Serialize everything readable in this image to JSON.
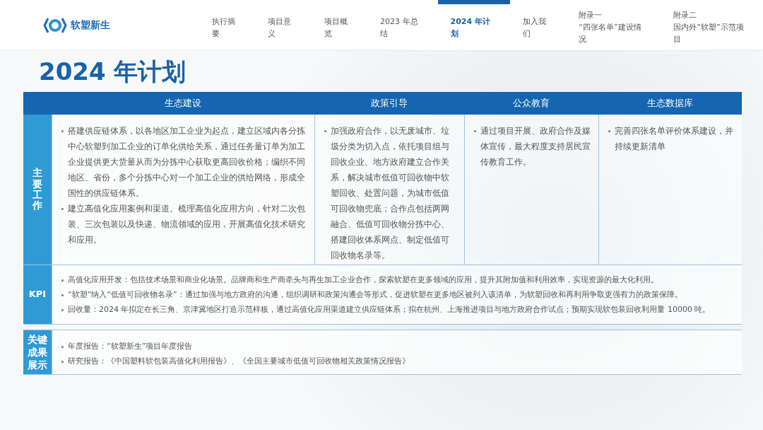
{
  "logo": {
    "name": "软塑新生"
  },
  "nav": [
    {
      "lines": [
        "执行摘要"
      ],
      "selected": false
    },
    {
      "lines": [
        "项目意义"
      ],
      "selected": false
    },
    {
      "lines": [
        "项目概览"
      ],
      "selected": false
    },
    {
      "lines": [
        "2023 年总结"
      ],
      "selected": false
    },
    {
      "lines": [
        "2024 年计划"
      ],
      "selected": true
    },
    {
      "lines": [
        "加入我们"
      ],
      "selected": false
    },
    {
      "lines": [
        "附录一",
        "“四张名单”建设情况"
      ],
      "selected": false
    },
    {
      "lines": [
        "附录二",
        "国内外“软塑”示范项目"
      ],
      "selected": false
    }
  ],
  "title": "2024 年计划",
  "table": {
    "columns": [
      "生态建设",
      "政策引导",
      "公众教育",
      "生态数据库"
    ],
    "rows": [
      {
        "label": "主要工作",
        "kind": "stacked",
        "cells": [
          [
            "搭建供应链体系，以各地区加工企业为起点，建立区域内各分拣中心软塑到加工企业的订单化供给关系，通过任务量订单为加工企业提供更大货量从而为分拣中心获取更高回收价格；编织不同地区、省份，多个分拣中心对一个加工企业的供给网络，形成全国性的供应链体系。",
            "建立高值化应用案例和渠道。梳理高值化应用方向，针对二次包装、三次包装以及快递、物流领域的应用，开展高值化技术研究和应用。"
          ],
          [
            "加强政府合作，以无废城市、垃圾分类为切入点，依托项目组与回收企业、地方政府建立合作关系，解决城市低值可回收物中软塑回收、处置问题，为城市低值可回收物兜底；合作点包括两网融合、低值可回收物分拣中心、搭建回收体系网点、制定低值可回收物名录等。"
          ],
          [
            "通过项目开展、政府合作及媒体宣传，最大程度支持居民宣传教育工作。"
          ],
          [
            "完善四张名单评价体系建设，并持续更新清单"
          ]
        ]
      },
      {
        "label": "KPI",
        "kind": "plain",
        "items": [
          "高值化应用开发：包括技术场景和商业化场景。品牌商和生产商牵头与再生加工企业合作，探索软塑在更多领域的应用，提升其附加值和利用效率，实现资源的最大化利用。",
          "“软塑”纳入“低值可回收物名录”：通过加强与地方政府的沟通，组织调研和政策沟通会等形式，促进软塑在更多地区被列入该清单，为软塑回收和再利用争取更强有力的政策保障。",
          "回收量：2024 年拟定在长三角、京津冀地区打造示范样板，通过高值化应用渠道建立供应链体系；拟在杭州、上海推进项目与地方政府合作试点；预期实现软包装回收利用量 10000 吨。"
        ]
      },
      {
        "label": "关键成果展示",
        "kind": "block",
        "items": [
          "年度报告：“软塑新生”项目年度报告",
          "研究报告：《中国塑料软包装高值化利用报告》、《全国主要城市低值可回收物相关政策情况报告》"
        ]
      }
    ]
  }
}
